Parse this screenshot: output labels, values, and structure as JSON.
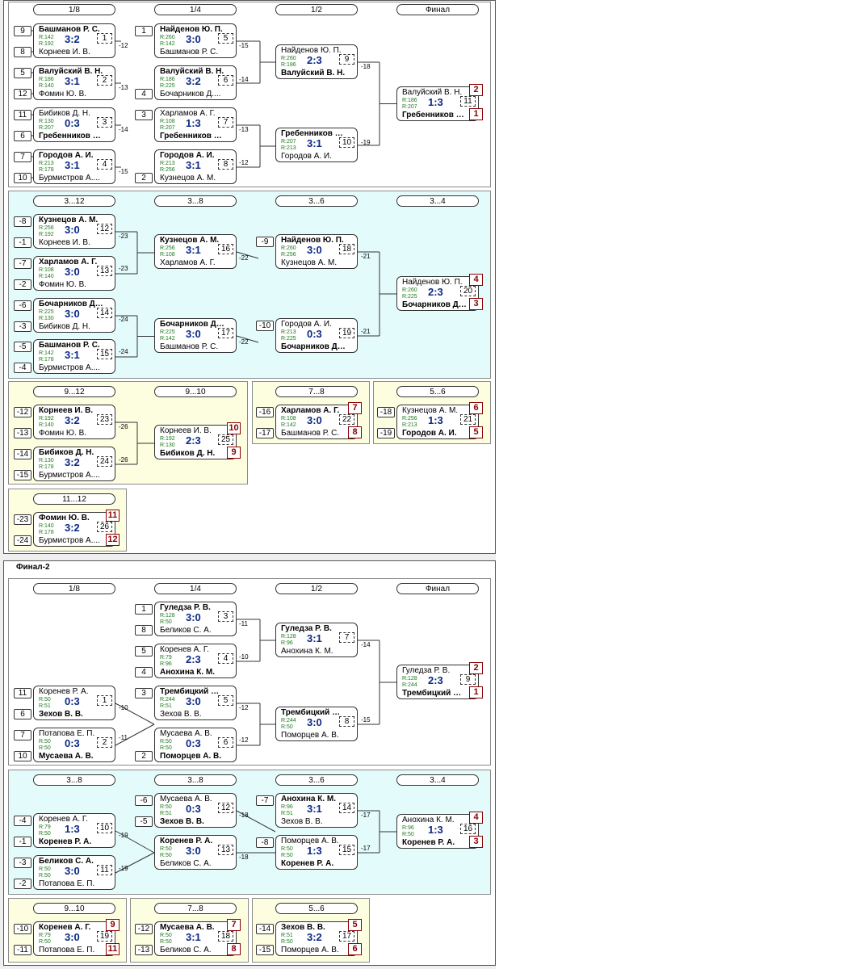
{
  "final2_title": "Финал-2",
  "s1": {
    "rounds": [
      "1/8",
      "1/4",
      "1/2",
      "Финал"
    ],
    "seeds": [
      "9",
      "8",
      "5",
      "12",
      "11",
      "6",
      "7",
      "10",
      "1",
      "4",
      "3",
      "2"
    ],
    "matches": [
      {
        "p1": "Башманов Р. С.",
        "r1": "R:142",
        "r2": "R:192",
        "p2": "Корнеев И. В.",
        "score": "3:2",
        "num": "1",
        "win": 1
      },
      {
        "p1": "Валуйский В. Н.",
        "r1": "R:186",
        "r2": "R:140",
        "p2": "Фомин Ю. В.",
        "score": "3:1",
        "num": "2",
        "win": 1
      },
      {
        "p1": "Бибиков Д. Н.",
        "r1": "R:130",
        "r2": "R:207",
        "p2": "Гребенников В...",
        "score": "0:3",
        "num": "3",
        "win": 2
      },
      {
        "p1": "Городов А. И.",
        "r1": "R:213",
        "r2": "R:178",
        "p2": "Бурмистров А....",
        "score": "3:1",
        "num": "4",
        "win": 1
      },
      {
        "p1": "Найденов Ю. П.",
        "r1": "R:260",
        "r2": "R:142",
        "p2": "Башманов Р. С.",
        "score": "3:0",
        "num": "5",
        "win": 1
      },
      {
        "p1": "Валуйский В. Н.",
        "r1": "R:186",
        "r2": "R:225",
        "p2": "Бочарников Д....",
        "score": "3:2",
        "num": "6",
        "win": 1
      },
      {
        "p1": "Харламов А. Г.",
        "r1": "R:108",
        "r2": "R:207",
        "p2": "Гребенников В...",
        "score": "1:3",
        "num": "7",
        "win": 2
      },
      {
        "p1": "Городов А. И.",
        "r1": "R:213",
        "r2": "R:256",
        "p2": "Кузнецов А. М.",
        "score": "3:1",
        "num": "8",
        "win": 1
      },
      {
        "p1": "Найденов Ю. П.",
        "r1": "R:260",
        "r2": "R:186",
        "p2": "Валуйский В. Н.",
        "score": "2:3",
        "num": "9",
        "win": 2
      },
      {
        "p1": "Гребенников В...",
        "r1": "R:207",
        "r2": "R:213",
        "p2": "Городов А. И.",
        "score": "3:1",
        "num": "10",
        "win": 1
      },
      {
        "p1": "Валуйский В. Н.",
        "r1": "R:186",
        "r2": "R:207",
        "p2": "Гребенников В...",
        "score": "1:3",
        "num": "11",
        "win": 2,
        "place1": "2",
        "place2": "1"
      }
    ],
    "conn": [
      "-12",
      "-13",
      "-14",
      "-15",
      "-15",
      "-14",
      "-13",
      "-12",
      "-18",
      "-19"
    ]
  },
  "s2": {
    "rounds": [
      "3...12",
      "3...8",
      "3...6",
      "3...4"
    ],
    "seeds": [
      "-8",
      "-1",
      "-7",
      "-2",
      "-6",
      "-3",
      "-5",
      "-4",
      "-9",
      "-10"
    ],
    "matches": [
      {
        "p1": "Кузнецов А. М.",
        "r1": "R:256",
        "r2": "R:192",
        "p2": "Корнеев И. В.",
        "score": "3:0",
        "num": "12",
        "win": 1
      },
      {
        "p1": "Харламов А. Г.",
        "r1": "R:108",
        "r2": "R:140",
        "p2": "Фомин Ю. В.",
        "score": "3:0",
        "num": "13",
        "win": 1
      },
      {
        "p1": "Бочарников Д....",
        "r1": "R:225",
        "r2": "R:130",
        "p2": "Бибиков Д. Н.",
        "score": "3:0",
        "num": "14",
        "win": 1
      },
      {
        "p1": "Башманов Р. С.",
        "r1": "R:142",
        "r2": "R:178",
        "p2": "Бурмистров А....",
        "score": "3:1",
        "num": "15",
        "win": 1
      },
      {
        "p1": "Кузнецов А. М.",
        "r1": "R:256",
        "r2": "R:108",
        "p2": "Харламов А. Г.",
        "score": "3:1",
        "num": "16",
        "win": 1
      },
      {
        "p1": "Бочарников Д....",
        "r1": "R:225",
        "r2": "R:142",
        "p2": "Башманов Р. С.",
        "score": "3:0",
        "num": "17",
        "win": 1
      },
      {
        "p1": "Найденов Ю. П.",
        "r1": "R:260",
        "r2": "R:256",
        "p2": "Кузнецов А. М.",
        "score": "3:0",
        "num": "18",
        "win": 1
      },
      {
        "p1": "Городов А. И.",
        "r1": "R:213",
        "r2": "R:225",
        "p2": "Бочарников Д....",
        "score": "0:3",
        "num": "19",
        "win": 2
      },
      {
        "p1": "Найденов Ю. П.",
        "r1": "R:260",
        "r2": "R:225",
        "p2": "Бочарников Д....",
        "score": "2:3",
        "num": "20",
        "win": 2,
        "place1": "4",
        "place2": "3"
      }
    ],
    "conn": [
      "-23",
      "-23",
      "-24",
      "-24",
      "-22",
      "-22",
      "-21",
      "-21"
    ]
  },
  "s3": {
    "rounds": [
      "9...12",
      "9...10"
    ],
    "seeds": [
      "-12",
      "-13",
      "-14",
      "-15"
    ],
    "matches": [
      {
        "p1": "Корнеев И. В.",
        "r1": "R:192",
        "r2": "R:140",
        "p2": "Фомин Ю. В.",
        "score": "3:2",
        "num": "23",
        "win": 1
      },
      {
        "p1": "Бибиков Д. Н.",
        "r1": "R:130",
        "r2": "R:178",
        "p2": "Бурмистров А....",
        "score": "3:2",
        "num": "24",
        "win": 1
      },
      {
        "p1": "Корнеев И. В.",
        "r1": "R:192",
        "r2": "R:130",
        "p2": "Бибиков Д. Н.",
        "score": "2:3",
        "num": "25",
        "win": 2,
        "place1": "10",
        "place2": "9"
      }
    ],
    "conn": [
      "-26",
      "-26"
    ]
  },
  "s4": {
    "round": "7...8",
    "seeds": [
      "-16",
      "-17"
    ],
    "match": {
      "p1": "Харламов А. Г.",
      "r1": "R:108",
      "r2": "R:142",
      "p2": "Башманов Р. С.",
      "score": "3:0",
      "num": "22",
      "win": 1,
      "place1": "7",
      "place2": "8"
    }
  },
  "s5": {
    "round": "5...6",
    "seeds": [
      "-18",
      "-19"
    ],
    "match": {
      "p1": "Кузнецов А. М.",
      "r1": "R:256",
      "r2": "R:213",
      "p2": "Городов А. И.",
      "score": "1:3",
      "num": "21",
      "win": 2,
      "place1": "6",
      "place2": "5"
    }
  },
  "s6": {
    "round": "11...12",
    "seeds": [
      "-23",
      "-24"
    ],
    "match": {
      "p1": "Фомин Ю. В.",
      "r1": "R:140",
      "r2": "R:178",
      "p2": "Бурмистров А....",
      "score": "3:2",
      "num": "26",
      "win": 1,
      "place1": "11",
      "place2": "12"
    }
  },
  "f1": {
    "rounds": [
      "1/8",
      "1/4",
      "1/2",
      "Финал"
    ],
    "seeds": [
      "1",
      "8",
      "5",
      "4",
      "3",
      "2",
      "11",
      "6",
      "7",
      "10"
    ],
    "matches": [
      {
        "p1": "Гуледза Р. В.",
        "r1": "R:128",
        "r2": "R:50",
        "p2": "Беликов С. А.",
        "score": "3:0",
        "num": "3",
        "win": 1
      },
      {
        "p1": "Коренев А. Г.",
        "r1": "R:79",
        "r2": "R:96",
        "p2": "Анохина К. М.",
        "score": "2:3",
        "num": "4",
        "win": 2
      },
      {
        "p1": "Трембицкий В....",
        "r1": "R:244",
        "r2": "R:51",
        "p2": "Зехов В. В.",
        "score": "3:0",
        "num": "5",
        "win": 1
      },
      {
        "p1": "Мусаева А. В.",
        "r1": "R:50",
        "r2": "R:50",
        "p2": "Поморцев А. В.",
        "score": "0:3",
        "num": "6",
        "win": 2
      },
      {
        "p1": "Коренев Р. А.",
        "r1": "R:50",
        "r2": "R:51",
        "p2": "Зехов В. В.",
        "score": "0:3",
        "num": "1",
        "win": 2
      },
      {
        "p1": "Потапова Е. П.",
        "r1": "R:50",
        "r2": "R:50",
        "p2": "Мусаева А. В.",
        "score": "0:3",
        "num": "2",
        "win": 2
      },
      {
        "p1": "Гуледза Р. В.",
        "r1": "R:128",
        "r2": "R:96",
        "p2": "Анохина К. М.",
        "score": "3:1",
        "num": "7",
        "win": 1
      },
      {
        "p1": "Трембицкий В....",
        "r1": "R:244",
        "r2": "R:50",
        "p2": "Поморцев А. В.",
        "score": "3:0",
        "num": "8",
        "win": 1
      },
      {
        "p1": "Гуледза Р. В.",
        "r1": "R:128",
        "r2": "R:244",
        "p2": "Трембицкий В....",
        "score": "2:3",
        "num": "9",
        "win": 2,
        "place1": "2",
        "place2": "1"
      }
    ],
    "conn": [
      "-11",
      "-10",
      "-12",
      "-12",
      "-10",
      "-11",
      "-14",
      "-15"
    ]
  },
  "f2": {
    "rounds": [
      "3...8",
      "3...8",
      "3...6",
      "3...4"
    ],
    "seeds": [
      "-4",
      "-1",
      "-3",
      "-2",
      "-6",
      "-5",
      "-7",
      "-8"
    ],
    "matches": [
      {
        "p1": "Коренев А. Г.",
        "r1": "R:79",
        "r2": "R:50",
        "p2": "Коренев Р. А.",
        "score": "1:3",
        "num": "10",
        "win": 2
      },
      {
        "p1": "Беликов С. А.",
        "r1": "R:50",
        "r2": "R:50",
        "p2": "Потапова Е. П.",
        "score": "3:0",
        "num": "11",
        "win": 1
      },
      {
        "p1": "Мусаева А. В.",
        "r1": "R:50",
        "r2": "R:51",
        "p2": "Зехов В. В.",
        "score": "0:3",
        "num": "12",
        "win": 2
      },
      {
        "p1": "Коренев Р. А.",
        "r1": "R:50",
        "r2": "R:50",
        "p2": "Беликов С. А.",
        "score": "3:0",
        "num": "13",
        "win": 1
      },
      {
        "p1": "Анохина К. М.",
        "r1": "R:96",
        "r2": "R:51",
        "p2": "Зехов В. В.",
        "score": "3:1",
        "num": "14",
        "win": 1
      },
      {
        "p1": "Поморцев А. В.",
        "r1": "R:50",
        "r2": "R:50",
        "p2": "Коренев Р. А.",
        "score": "1:3",
        "num": "15",
        "win": 2
      },
      {
        "p1": "Анохина К. М.",
        "r1": "R:96",
        "r2": "R:50",
        "p2": "Коренев Р. А.",
        "score": "1:3",
        "num": "16",
        "win": 2,
        "place1": "4",
        "place2": "3"
      }
    ],
    "conn": [
      "-19",
      "-19",
      "-18",
      "-18",
      "-17",
      "-17"
    ]
  },
  "f3": {
    "round": "9...10",
    "seeds": [
      "-10",
      "-11"
    ],
    "match": {
      "p1": "Коренев А. Г.",
      "r1": "R:79",
      "r2": "R:50",
      "p2": "Потапова Е. П.",
      "score": "3:0",
      "num": "19",
      "win": 1,
      "place1": "9",
      "place2": "11"
    }
  },
  "f4": {
    "round": "7...8",
    "seeds": [
      "-12",
      "-13"
    ],
    "match": {
      "p1": "Мусаева А. В.",
      "r1": "R:50",
      "r2": "R:50",
      "p2": "Беликов С. А.",
      "score": "3:1",
      "num": "18",
      "win": 1,
      "place1": "7",
      "place2": "8"
    }
  },
  "f5": {
    "round": "5...6",
    "seeds": [
      "-14",
      "-15"
    ],
    "match": {
      "p1": "Зехов В. В.",
      "r1": "R:51",
      "r2": "R:50",
      "p2": "Поморцев А. В.",
      "score": "3:2",
      "num": "17",
      "win": 1,
      "place1": "5",
      "place2": "6"
    }
  }
}
